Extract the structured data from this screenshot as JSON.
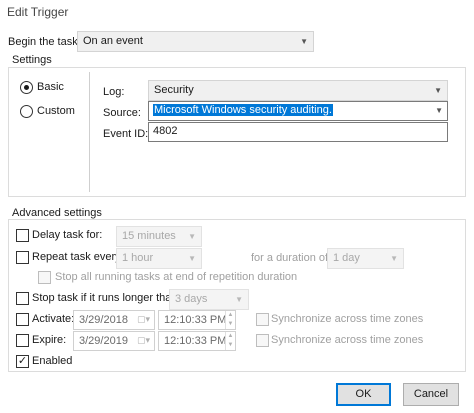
{
  "window": {
    "title": "Edit Trigger"
  },
  "begin_task": {
    "label": "Begin the task:",
    "value": "On an event"
  },
  "settings": {
    "heading": "Settings",
    "options": [
      {
        "label": "Basic",
        "selected": true
      },
      {
        "label": "Custom",
        "selected": false
      }
    ],
    "log": {
      "label": "Log:",
      "value": "Security"
    },
    "source": {
      "label": "Source:",
      "value": "Microsoft Windows security auditing."
    },
    "event_id": {
      "label": "Event ID:",
      "value": "4802"
    }
  },
  "advanced": {
    "heading": "Advanced settings",
    "delay": {
      "label": "Delay task for:",
      "checked": false,
      "value": "15 minutes"
    },
    "repeat": {
      "label": "Repeat task every:",
      "checked": false,
      "value": "1 hour",
      "duration_label": "for a duration of:",
      "duration_value": "1 day",
      "stop_all_label": "Stop all running tasks at end of repetition duration"
    },
    "stop_longer": {
      "label": "Stop task if it runs longer than:",
      "checked": false,
      "value": "3 days"
    },
    "activate": {
      "label": "Activate:",
      "checked": false,
      "date": "3/29/2018",
      "time": "12:10:33 PM",
      "sync_label": "Synchronize across time zones"
    },
    "expire": {
      "label": "Expire:",
      "checked": false,
      "date": "3/29/2019",
      "time": "12:10:33 PM",
      "sync_label": "Synchronize across time zones"
    },
    "enabled": {
      "label": "Enabled",
      "checked": true
    }
  },
  "buttons": {
    "ok": "OK",
    "cancel": "Cancel"
  },
  "icons": {
    "dropdown": "chevron-down-icon",
    "calendar": "calendar-icon",
    "checkmark": "✓"
  }
}
